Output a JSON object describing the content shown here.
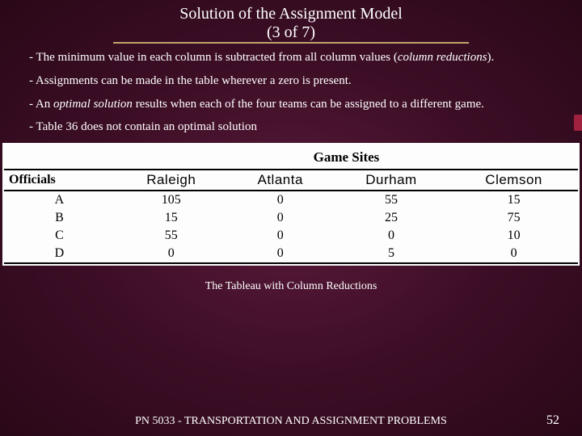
{
  "title": {
    "line1": "Solution of the Assignment Model",
    "line2": "(3 of 7)"
  },
  "paragraphs": {
    "p1a": "- The minimum value in each column is subtracted from all column values (",
    "p1b": "column reductions",
    "p1c": ").",
    "p2": "- Assignments can be made in the table wherever a zero is present.",
    "p3a": "- An ",
    "p3b": "optimal solution",
    "p3c": " results when each of the four teams can be assigned to a different game.",
    "p4": "- Table 36 does not contain an optimal solution"
  },
  "table": {
    "supertitle": "Game Sites",
    "row_label": "Officials",
    "columns": [
      "Raleigh",
      "Atlanta",
      "Durham",
      "Clemson"
    ],
    "rows": [
      {
        "label": "A",
        "values": [
          "105",
          "0",
          "55",
          "15"
        ]
      },
      {
        "label": "B",
        "values": [
          "15",
          "0",
          "25",
          "75"
        ]
      },
      {
        "label": "C",
        "values": [
          "55",
          "0",
          "0",
          "10"
        ]
      },
      {
        "label": "D",
        "values": [
          "0",
          "0",
          "5",
          "0"
        ]
      }
    ]
  },
  "caption": "The Tableau with Column Reductions",
  "footer": {
    "course": "PN 5033 - TRANSPORTATION AND ASSIGNMENT PROBLEMS",
    "page": "52"
  },
  "chart_data": {
    "type": "table",
    "title": "Game Sites — Tableau with Column Reductions",
    "columns": [
      "Officials",
      "Raleigh",
      "Atlanta",
      "Durham",
      "Clemson"
    ],
    "rows": [
      [
        "A",
        105,
        0,
        55,
        15
      ],
      [
        "B",
        15,
        0,
        25,
        75
      ],
      [
        "C",
        55,
        0,
        0,
        10
      ],
      [
        "D",
        0,
        0,
        5,
        0
      ]
    ]
  }
}
